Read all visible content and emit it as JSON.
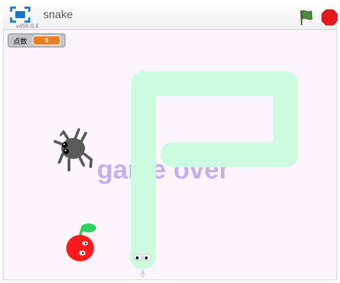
{
  "player": {
    "title": "snake",
    "version": "v456.0.4"
  },
  "controls": {
    "fullscreen_icon": "fullscreen-icon",
    "flag_icon": "green-flag-icon",
    "stop_icon": "stop-sign-icon"
  },
  "monitor": {
    "label": "点数",
    "value": "0"
  },
  "stage": {
    "game_over_text": "game over",
    "sprites": [
      "spider",
      "apple",
      "snake-head"
    ]
  },
  "colors": {
    "stage_bg": "#fcf5fe",
    "snake": "#ccfbe0",
    "game_over": "#c2b1ee",
    "monitor_value": "#ea7f24",
    "stop": "#e8161b",
    "flag": "#4c8c3c"
  }
}
